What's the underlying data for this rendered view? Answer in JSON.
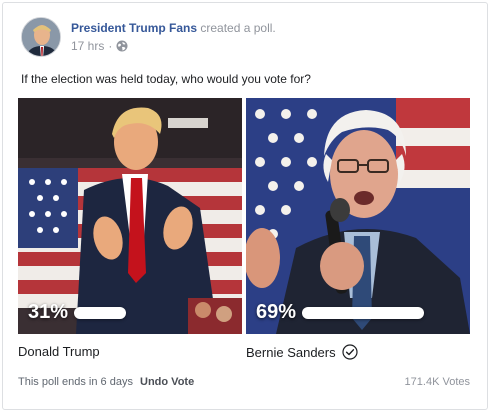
{
  "post": {
    "author": "President Trump Fans",
    "action": "created a poll.",
    "time": "17 hrs",
    "separator": "·",
    "privacy_icon": "globe-icon"
  },
  "poll": {
    "question": "If the election was held today, who would you vote for?",
    "options": [
      {
        "name": "Donald Trump",
        "percent_label": "31%",
        "percent": 31,
        "selected": false
      },
      {
        "name": "Bernie Sanders",
        "percent_label": "69%",
        "percent": 69,
        "selected": true,
        "selected_icon": "checkmark-circle-icon"
      }
    ],
    "ends_text": "This poll ends in 6 days",
    "undo_label": "Undo Vote",
    "votes": "171.4K Votes"
  },
  "colors": {
    "link": "#365899",
    "muted": "#90949c",
    "border": "#dddfe2"
  }
}
